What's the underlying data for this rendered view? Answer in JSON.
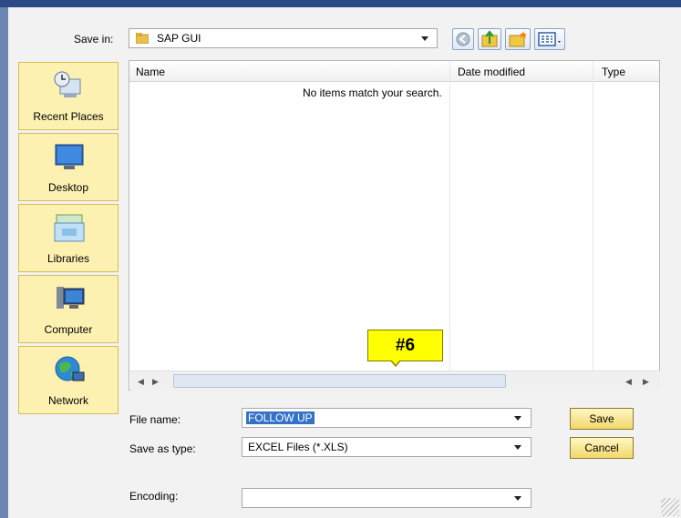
{
  "save_in": {
    "label": "Save in:",
    "value": "SAP GUI"
  },
  "toolbar": {
    "buttons": [
      "back-icon",
      "up-folder-icon",
      "new-folder-icon",
      "views-menu-icon"
    ]
  },
  "places": [
    {
      "label": "Recent Places",
      "icon": "recent-places-icon"
    },
    {
      "label": "Desktop",
      "icon": "desktop-icon"
    },
    {
      "label": "Libraries",
      "icon": "libraries-icon"
    },
    {
      "label": "Computer",
      "icon": "computer-icon"
    },
    {
      "label": "Network",
      "icon": "network-icon"
    }
  ],
  "file_list": {
    "columns": [
      "Name",
      "Date modified",
      "Type"
    ],
    "empty_message": "No items match your search."
  },
  "callout": {
    "text": "#6"
  },
  "file_name": {
    "label": "File name:",
    "value": "FOLLOW UP"
  },
  "save_as_type": {
    "label": "Save as type:",
    "value": "EXCEL Files (*.XLS)"
  },
  "encoding": {
    "label": "Encoding:",
    "value": ""
  },
  "buttons": {
    "save": "Save",
    "cancel": "Cancel"
  },
  "colors": {
    "title_bar": "#2b4a86",
    "place_bg": "#fdf1b2",
    "button_bg": "#f2d86a",
    "callout": "#ffff00",
    "selection": "#3472c8"
  }
}
